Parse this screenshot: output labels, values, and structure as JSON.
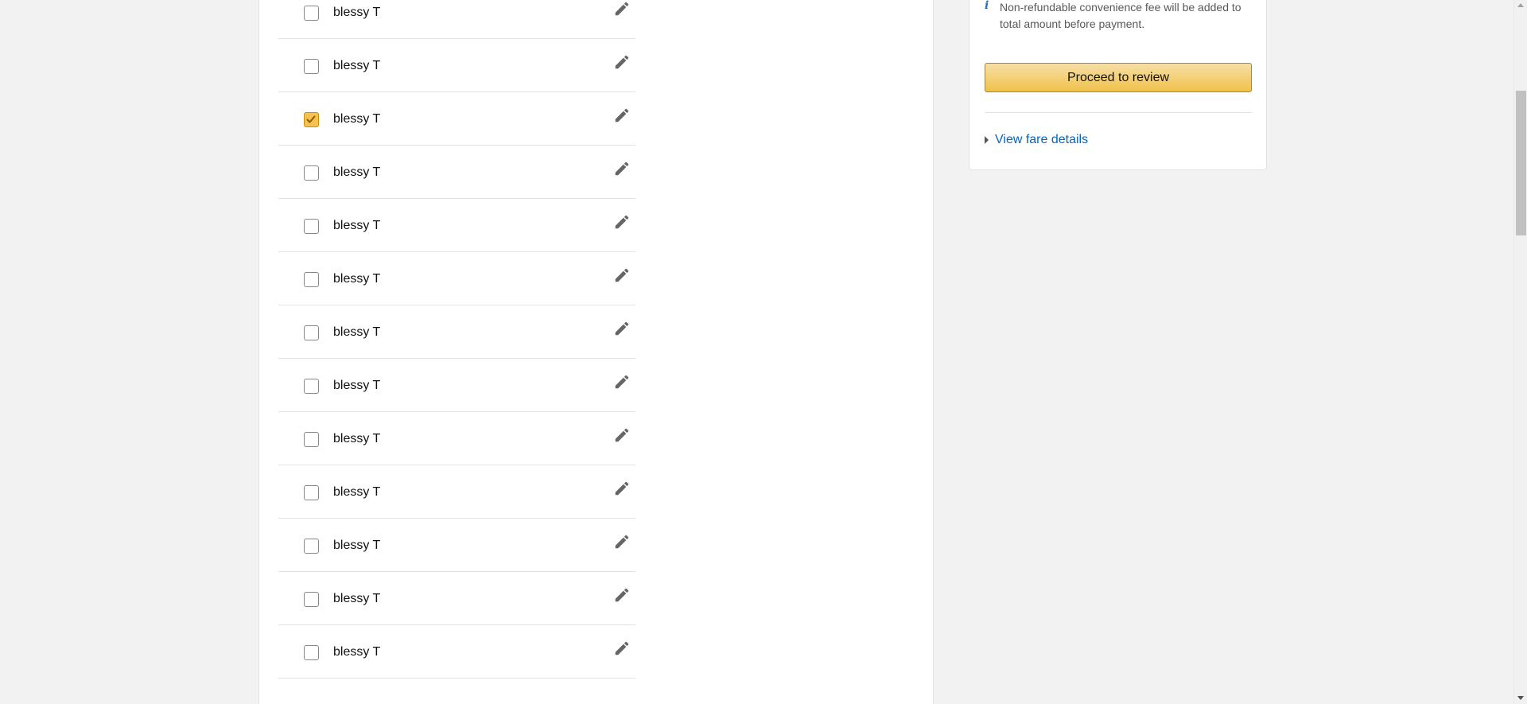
{
  "travellers": [
    {
      "name": "blessy T",
      "checked": false
    },
    {
      "name": "blessy T",
      "checked": false
    },
    {
      "name": "blessy T",
      "checked": true
    },
    {
      "name": "blessy T",
      "checked": false
    },
    {
      "name": "blessy T",
      "checked": false
    },
    {
      "name": "blessy T",
      "checked": false
    },
    {
      "name": "blessy T",
      "checked": false
    },
    {
      "name": "blessy T",
      "checked": false
    },
    {
      "name": "blessy T",
      "checked": false
    },
    {
      "name": "blessy T",
      "checked": false
    },
    {
      "name": "blessy T",
      "checked": false
    },
    {
      "name": "blessy T",
      "checked": false
    },
    {
      "name": "blessy T",
      "checked": false
    }
  ],
  "summary": {
    "fee_note": "Non-refundable convenience fee will be added to total amount before payment.",
    "proceed_label": "Proceed to review",
    "fare_link_label": "View fare details"
  },
  "icons": {
    "info": "info-icon",
    "edit": "pencil-icon",
    "checkmark": "checkmark-icon",
    "caret": "caret-right-icon"
  },
  "colors": {
    "checkbox_checked": "#f5c151",
    "button_gradient_top": "#f7dfa5",
    "button_gradient_bottom": "#f0c14b",
    "link": "#0066c0",
    "info_icon": "#2a6fb5"
  }
}
